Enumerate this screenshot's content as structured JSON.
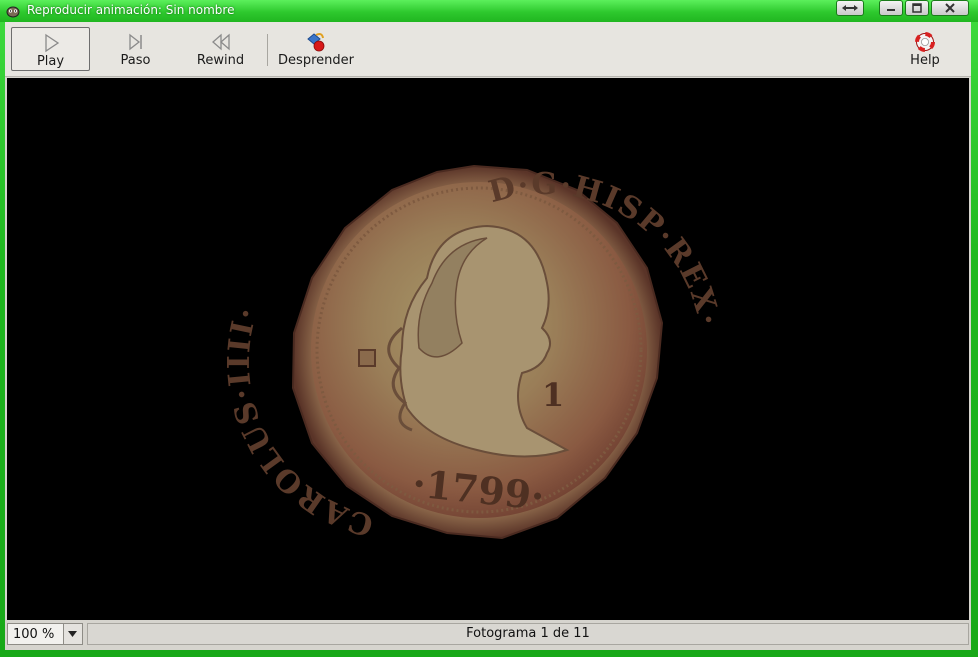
{
  "window": {
    "title": "Reproducir animación: Sin nombre",
    "accent_color": "#2ec92e"
  },
  "toolbar": {
    "play_label": "Play",
    "step_label": "Paso",
    "rewind_label": "Rewind",
    "detach_label": "Desprender",
    "help_label": "Help"
  },
  "coin": {
    "legend_left": "CAROLUS·IIII·",
    "legend_right": "D·G·HISP·REX·",
    "year": "·1799·",
    "value_mark": "1"
  },
  "statusbar": {
    "zoom_value": "100 %",
    "frame_text": "Fotograma 1 de 11"
  },
  "icons": [
    "app-icon",
    "resize-icon",
    "minimize-icon",
    "maximize-icon",
    "close-icon",
    "play-icon",
    "step-icon",
    "rewind-icon",
    "detach-icon",
    "help-icon",
    "dropdown-arrow-icon"
  ]
}
